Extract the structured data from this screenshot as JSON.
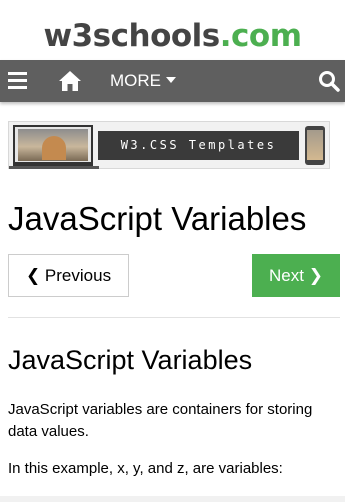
{
  "header": {
    "logo_main": "w3schools",
    "logo_tld": ".com"
  },
  "navbar": {
    "menu_icon": "hamburger-icon",
    "home_icon": "home-icon",
    "more_label": "MORE",
    "search_icon": "search-icon"
  },
  "ad": {
    "banner_text": "W3.CSS Templates"
  },
  "page": {
    "title": "JavaScript Variables",
    "prev_label": "Previous",
    "next_label": "Next",
    "section_title": "JavaScript Variables",
    "paragraph1": "JavaScript variables are containers for storing data values.",
    "paragraph2": "In this example, x, y, and z, are variables:"
  },
  "colors": {
    "brand_green": "#4CAF50",
    "navbar_bg": "#5f5f5f",
    "logo_gray": "#444444"
  }
}
